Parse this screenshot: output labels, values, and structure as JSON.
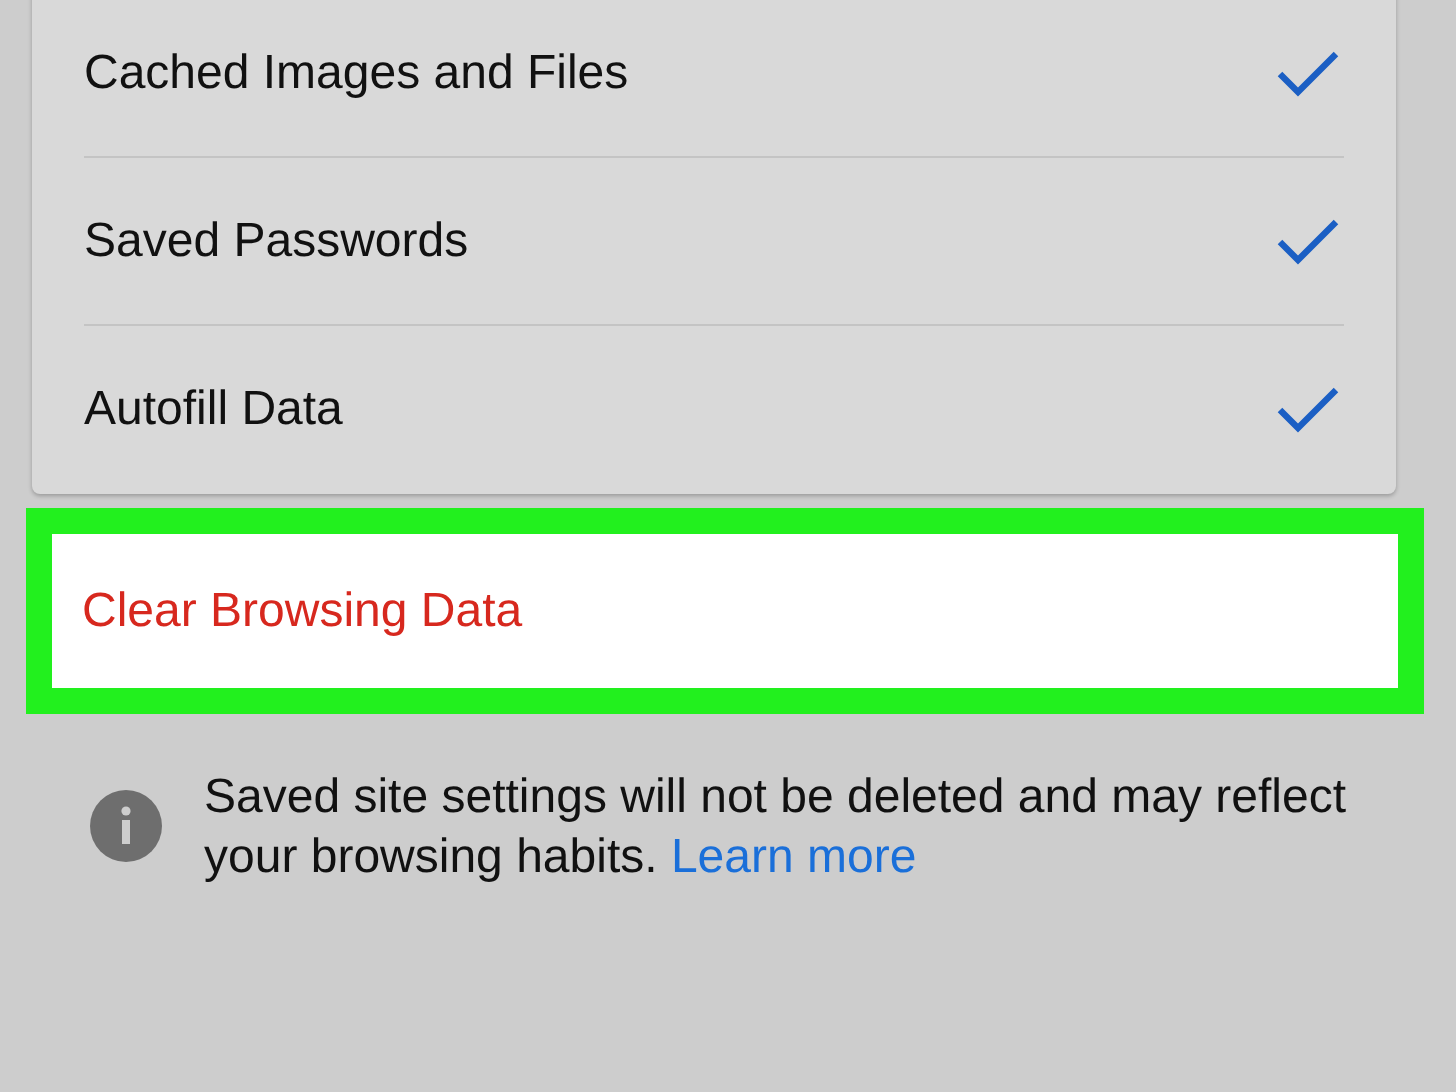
{
  "items": [
    {
      "label": "Cached Images and Files",
      "checked": true
    },
    {
      "label": "Saved Passwords",
      "checked": true
    },
    {
      "label": "Autofill Data",
      "checked": true
    }
  ],
  "clear_button": {
    "label": "Clear Browsing Data",
    "highlighted": true
  },
  "info": {
    "text": "Saved site settings will not be deleted and may reflect your browsing habits.",
    "link": "Learn more"
  }
}
